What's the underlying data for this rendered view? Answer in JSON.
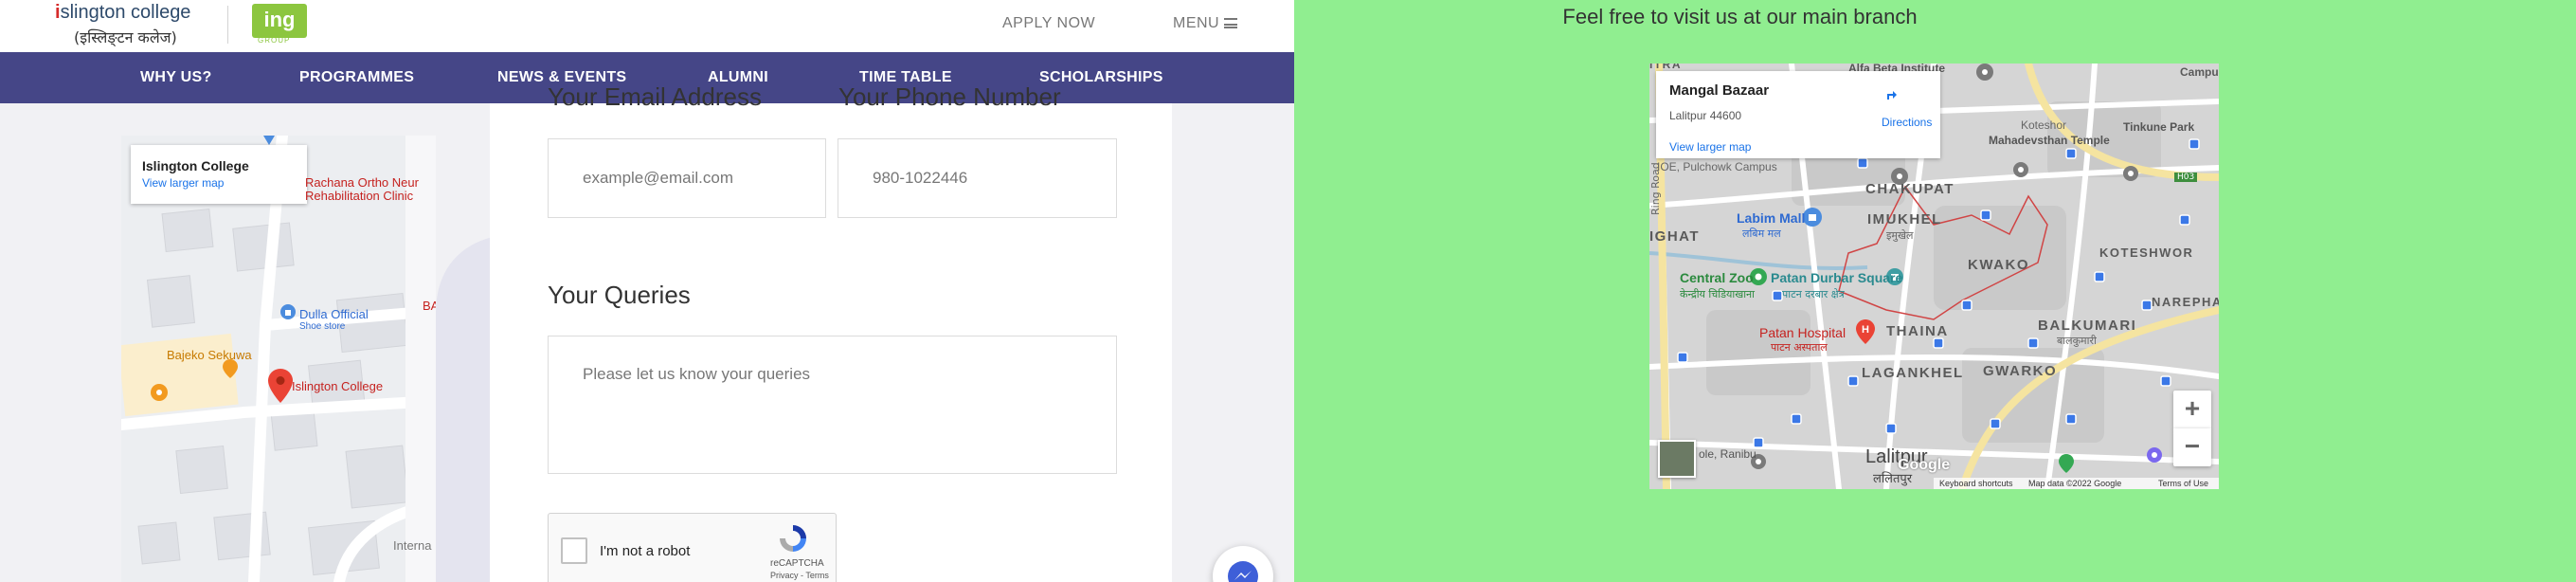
{
  "header": {
    "logo_text": "slington college",
    "logo_initial": "i",
    "logo_devanagari": "(इस्लिङ्टन कलेज)",
    "group_logo": "ing",
    "group_sub": "GROUP",
    "apply_now": "APPLY NOW",
    "menu": "MENU"
  },
  "nav": {
    "items": [
      {
        "label": "WHY US?"
      },
      {
        "label": "PROGRAMMES"
      },
      {
        "label": "NEWS & EVENTS"
      },
      {
        "label": "ALUMNI"
      },
      {
        "label": "TIME TABLE"
      },
      {
        "label": "SCHOLARSHIPS"
      }
    ]
  },
  "small_map": {
    "title": "Islington College",
    "view_larger": "View larger map",
    "labels": {
      "rachana": "Rachana Ortho Neur",
      "rachana2": "Rehabilitation Clinic",
      "dulla": "Dulla Official",
      "dulla_sub": "Shoe store",
      "bajeko": "Bajeko Sekuwa",
      "islington": "Islington College",
      "bai": "BAI",
      "internal": "Interna"
    }
  },
  "form": {
    "email_label": "Your Email Address",
    "phone_label": "Your Phone Number",
    "email_placeholder": "example@email.com",
    "phone_placeholder": "980-1022446",
    "queries_label": "Your Queries",
    "queries_placeholder": "Please let us know your queries",
    "captcha_label": "I'm not a robot",
    "captcha_brand": "reCAPTCHA",
    "captcha_terms": "Privacy - Terms"
  },
  "right": {
    "visit_text": "Feel free to visit us at our main branch",
    "map": {
      "title": "Mangal Bazaar",
      "address": "Lalitpur 44600",
      "directions": "Directions",
      "view_larger": "View larger map",
      "areas": {
        "alfa": "Alfa Beta Institute",
        "chakupat": "CHAKUPAT",
        "imukhel": "IMUKHEL",
        "kwako": "KWAKO",
        "thaina": "THAINA",
        "laganhkel": "LAGANKHEL",
        "gwarko": "GWARKO",
        "balkumari": "BALKUMARI",
        "koteshwor": "KOTESHWOR",
        "narephat": "NAREPHAT",
        "ighat": "IGHAT",
        "lalitpur": "Lalitpur",
        "koteshor": "Koteshor",
        "mahadevsthan": "Mahadevsthan Temple",
        "tinkune": "Tinkune Park",
        "campus": "Campu",
        "itra": "ITRA"
      },
      "places": {
        "ioe": "IOE, Pulchowk Campus",
        "labim": "Labim Mall",
        "labim_sub": "लबिम मल",
        "central_zoo": "Central Zoo",
        "central_zoo_sub": "केन्द्रीय चिडियाखाना",
        "patan_durbar": "Patan Durbar Square",
        "patan_durbar_sub": "पाटन दरबार क्षेत्र",
        "patan_hospital": "Patan Hospital",
        "patan_hospital_sub": "पाटन अस्पताल",
        "ranibu": "ole, Ranibu",
        "lalitpur_dev": "ललितपुर",
        "balkumari_dev": "बालकुमारी",
        "chakupat_dev": "इमुखेल",
        "ring_road": "Ring Road",
        "h03": "H03"
      },
      "zoom_in": "+",
      "zoom_out": "−",
      "footer_shortcuts": "Keyboard shortcuts",
      "footer_data": "Map data ©2022 Google",
      "footer_terms": "Terms of Use",
      "google": "Google"
    }
  }
}
